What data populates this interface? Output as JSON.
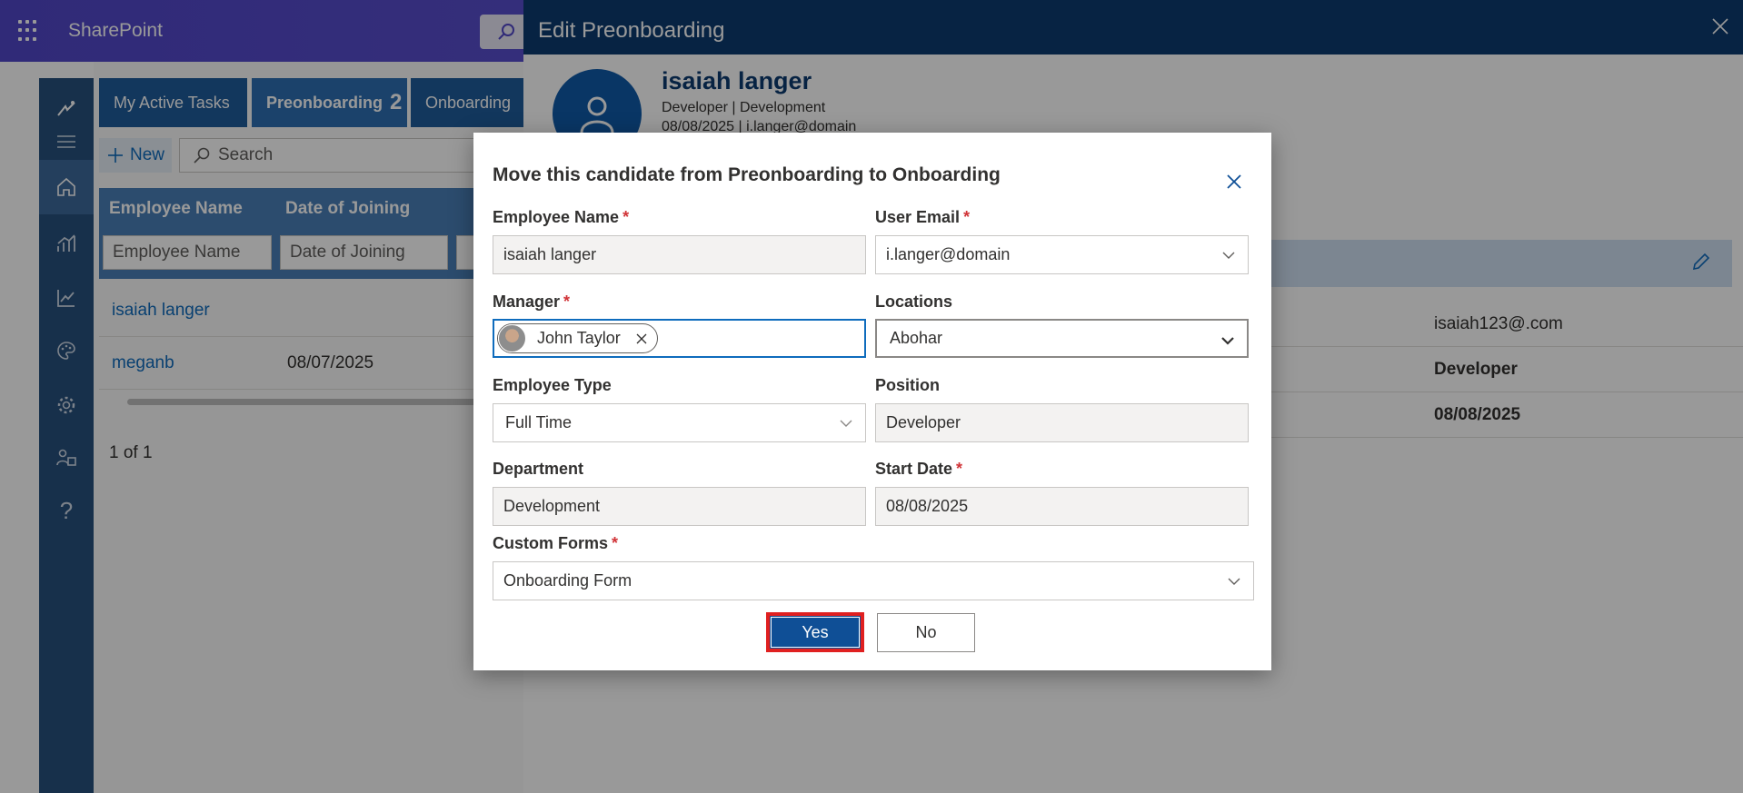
{
  "app": {
    "brand": "SharePoint"
  },
  "tabs": [
    {
      "label": "My Active Tasks"
    },
    {
      "label": "Preonboarding",
      "count": "2"
    },
    {
      "label": "Onboarding"
    }
  ],
  "command_bar": {
    "new_label": "New",
    "search_placeholder": "Search"
  },
  "grid": {
    "columns": [
      "Employee Name",
      "Date of Joining"
    ],
    "filters": [
      "Employee Name",
      "Date of Joining"
    ],
    "rows": [
      {
        "name": "isaiah langer",
        "date": ""
      },
      {
        "name": "meganb",
        "date": "08/07/2025"
      }
    ],
    "pager": "1 of 1"
  },
  "panel": {
    "title": "Edit Preonboarding",
    "name": "isaiah langer",
    "subtitle": "Developer | Development",
    "subtitle2": "08/08/2025 | i.langer@domain",
    "details": [
      "isaiah123@.com",
      "Developer",
      "08/08/2025"
    ]
  },
  "dialog": {
    "title": "Move this candidate from Preonboarding to Onboarding",
    "employee_name": {
      "label": "Employee Name",
      "value": "isaiah langer"
    },
    "user_email": {
      "label": "User Email",
      "value": "i.langer@domain"
    },
    "manager": {
      "label": "Manager",
      "value": "John Taylor"
    },
    "locations": {
      "label": "Locations",
      "value": "Abohar"
    },
    "employee_type": {
      "label": "Employee Type",
      "value": "Full Time"
    },
    "position": {
      "label": "Position",
      "value": "Developer"
    },
    "department": {
      "label": "Department",
      "value": "Development"
    },
    "start_date": {
      "label": "Start Date",
      "value": "08/08/2025"
    },
    "custom_forms": {
      "label": "Custom Forms",
      "value": "Onboarding Form"
    },
    "required_mark": "*",
    "yes_label": "Yes",
    "no_label": "No"
  },
  "colors": {
    "accent": "#0f4f96",
    "header": "#0d3b71",
    "required": "#d13438",
    "highlight": "#e02020"
  }
}
